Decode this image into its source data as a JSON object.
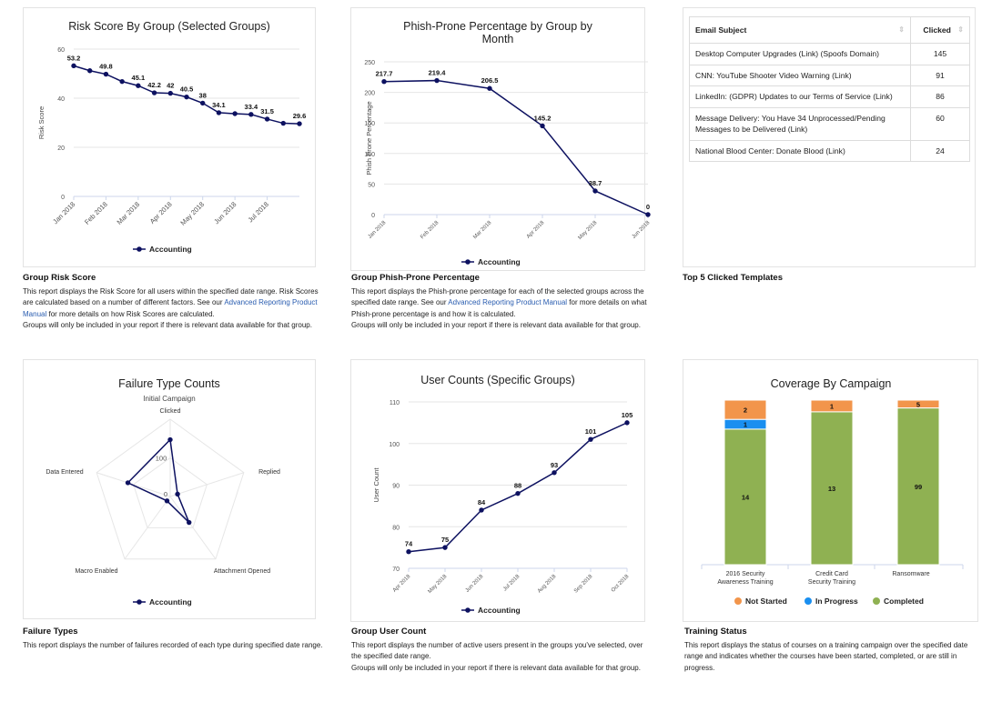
{
  "colors": {
    "series": "#0d1160",
    "not_started": "#f2954b",
    "in_progress": "#1a8ff0",
    "completed": "#8fb152",
    "link": "#2a5db0",
    "grid": "#e6e6e6"
  },
  "chart_data": [
    {
      "id": "risk",
      "type": "line",
      "title": "Risk Score By Group (Selected Groups)",
      "ylabel": "Risk Score",
      "ylim": [
        0,
        60
      ],
      "yticks": [
        0,
        20,
        40,
        60
      ],
      "x_tick_labels": [
        "Jan 2018",
        "Feb 2018",
        "Mar 2018",
        "Apr 2018",
        "May 2018",
        "Jun 2018",
        "Jul 2018"
      ],
      "series": [
        {
          "name": "Accounting",
          "values": [
            53.2,
            51.2,
            49.8,
            46.8,
            45.1,
            42.2,
            42,
            40.5,
            38,
            34.1,
            33.7,
            33.4,
            31.5,
            29.8,
            29.6
          ],
          "data_labels": [
            "53.2",
            null,
            "49.8",
            null,
            "45.1",
            "42.2",
            "42",
            "40.5",
            "38",
            "34.1",
            null,
            "33.4",
            "31.5",
            null,
            "29.6"
          ]
        }
      ],
      "legend": "bottom",
      "grid": true
    },
    {
      "id": "phish",
      "type": "line",
      "title": "Phish-Prone Percentage by Group by Month",
      "ylabel": "Phish Prone Percentage",
      "ylim": [
        0,
        250
      ],
      "yticks": [
        0,
        50,
        100,
        150,
        200,
        250
      ],
      "x_tick_labels": [
        "Jan 2018",
        "Feb 2018",
        "Mar 2018",
        "Apr 2018",
        "May 2018",
        "Jun 2018"
      ],
      "series": [
        {
          "name": "Accounting",
          "values": [
            217.7,
            219.4,
            206.5,
            145.2,
            38.7,
            0
          ],
          "data_labels": [
            "217.7",
            "219.4",
            "206.5",
            "145.2",
            "38.7",
            "0"
          ]
        }
      ],
      "legend": "bottom",
      "grid": true
    },
    {
      "id": "failure",
      "type": "radar",
      "title": "Failure Type Counts",
      "subtitle": "Initial Campaign",
      "categories": [
        "Clicked",
        "Replied",
        "Attachment Opened",
        "Macro Enabled",
        "Data Entered"
      ],
      "rlim": [
        0,
        200
      ],
      "rticks": [
        "0",
        "100"
      ],
      "series": [
        {
          "name": "Accounting",
          "values": [
            147,
            20,
            83,
            14,
            115
          ]
        }
      ],
      "legend": "bottom"
    },
    {
      "id": "users",
      "type": "line",
      "title": "User Counts (Specific Groups)",
      "ylabel": "User Count",
      "ylim": [
        70,
        110
      ],
      "yticks": [
        70,
        80,
        90,
        100,
        110
      ],
      "x_tick_labels": [
        "Apr 2018",
        "May 2018",
        "Jun 2018",
        "Jul 2018",
        "Aug 2018",
        "Sep 2018",
        "Oct 2018"
      ],
      "series": [
        {
          "name": "Accounting",
          "values": [
            74,
            75,
            84,
            88,
            93,
            101,
            105
          ],
          "data_labels": [
            "74",
            "75",
            "84",
            "88",
            "93",
            "101",
            "105"
          ]
        }
      ],
      "legend": "bottom",
      "grid": true
    },
    {
      "id": "coverage",
      "type": "bar",
      "stacking": "percent",
      "title": "Coverage By Campaign",
      "categories": [
        "2016 Security Awareness Training",
        "Credit Card Security Training",
        "Ransomware"
      ],
      "series": [
        {
          "name": "Not Started",
          "values": [
            2,
            1,
            5
          ]
        },
        {
          "name": "In Progress",
          "values": [
            1,
            0,
            0
          ]
        },
        {
          "name": "Completed",
          "values": [
            14,
            13,
            99
          ]
        }
      ],
      "legend": "bottom"
    }
  ],
  "top_templates": {
    "headers": [
      "Email Subject",
      "Clicked"
    ],
    "rows": [
      [
        "Desktop Computer Upgrades (Link) (Spoofs Domain)",
        "145"
      ],
      [
        "CNN: YouTube Shooter Video Warning (Link)",
        "91"
      ],
      [
        "LinkedIn: (GDPR) Updates to our Terms of Service (Link)",
        "86"
      ],
      [
        "Message Delivery: You Have 34 Unprocessed/Pending Messages to be Delivered (Link)",
        "60"
      ],
      [
        "National Blood Center: Donate Blood (Link)",
        "24"
      ]
    ]
  },
  "descriptions": {
    "risk": {
      "title": "Group Risk Score",
      "pre": "This report displays the Risk Score for all users within the specified date range. Risk Scores are calculated based on a number of different factors. See our ",
      "link": "Advanced Reporting Product Manual",
      "post": " for more details on how Risk Scores are calculated.",
      "note": "Groups will only be included in your report if there is relevant data available for that group."
    },
    "phish": {
      "title": "Group Phish-Prone Percentage",
      "pre": "This report displays the Phish-prone percentage for each of the selected groups across the specified date range. See our ",
      "link": "Advanced Reporting Product Manual",
      "post": " for more details on what Phish-prone percentage is and how it is calculated.",
      "note": "Groups will only be included in your report if there is relevant data available for that group."
    },
    "templates": {
      "title": "Top 5 Clicked Templates"
    },
    "failure": {
      "title": "Failure Types",
      "text": "This report displays the number of failures recorded of each type during specified date range."
    },
    "users": {
      "title": "Group User Count",
      "text": "This report displays the number of active users present in the groups you've selected, over the specified date range.",
      "note": "Groups will only be included in your report if there is relevant data available for that group."
    },
    "coverage": {
      "title": "Training Status",
      "text": "This report displays the status of courses on a training campaign over the specified date range and indicates whether the courses have been started, completed, or are still in progress."
    }
  }
}
